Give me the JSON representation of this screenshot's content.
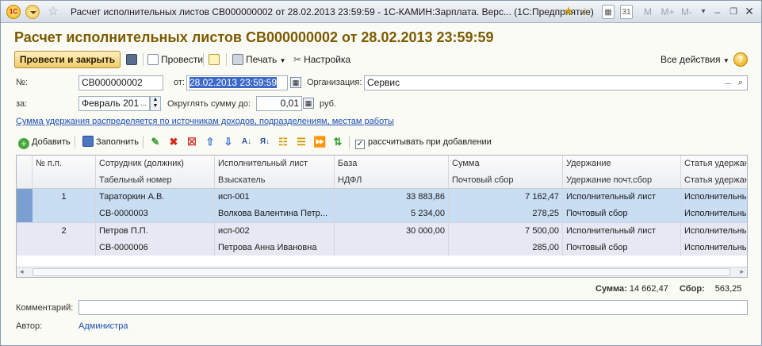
{
  "window": {
    "title": "Расчет исполнительных листов СВ000000002 от 28.02.2013 23:59:59 - 1С-КАМИН:Зарплата. Верс... (1С:Предприятие)",
    "logo_text": "1С",
    "right_controls": [
      "M",
      "M+",
      "M-"
    ]
  },
  "form": {
    "title": "Расчет исполнительных листов СВ000000002 от 28.02.2013 23:59:59"
  },
  "commands": {
    "post_and_close": "Провести и закрыть",
    "post": "Провести",
    "print": "Печать",
    "settings": "Настройка",
    "all_actions": "Все действия",
    "help": "?"
  },
  "fields": {
    "number_label": "№:",
    "number_value": "СВ000000002",
    "date_label": "от:",
    "date_value": "28.02.2013 23:59:59",
    "org_label": "Организация:",
    "org_value": "Сервис",
    "period_label": "за:",
    "period_value": "Февраль 201",
    "round_label": "Округлять сумму до:",
    "round_value": "0,01",
    "round_unit": "руб."
  },
  "info_link": "Сумма удержания распределяется по источникам доходов, подразделениям, местам работы",
  "table_toolbar": {
    "add": "Добавить",
    "fill": "Заполнить",
    "calc_on_add": "рассчитывать при добавлении",
    "calc_on_add_checked": true
  },
  "table": {
    "headers_top": [
      "№ п.п.",
      "Сотрудник (должник)",
      "Исполнительный лист",
      "База",
      "Сумма",
      "Удержание",
      "Статья удержан"
    ],
    "headers_bottom": [
      "",
      "Табельный номер",
      "Взыскатель",
      "НДФЛ",
      "Почтовый сбор",
      "Удержание почт.сбор",
      "Статья удержан"
    ],
    "rows": [
      {
        "num": "1",
        "employee": "Тараторкин А.В.",
        "tab_number": "СВ-0000003",
        "writ": "исп-001",
        "claimant": "Волкова Валентина Петр...",
        "base": "33 883,86",
        "ndfl": "5 234,00",
        "sum": "7 162,47",
        "postal": "278,25",
        "deduction": "Исполнительный лист",
        "postal_deduction": "Почтовый сбор",
        "article": "Исполнительнь",
        "article2": "Исполнительнь"
      },
      {
        "num": "2",
        "employee": "Петров П.П.",
        "tab_number": "СВ-0000006",
        "writ": "исп-002",
        "claimant": "Петрова Анна Ивановна",
        "base": "30 000,00",
        "ndfl": "",
        "sum": "7 500,00",
        "postal": "285,00",
        "deduction": "Исполнительный лист",
        "postal_deduction": "Почтовый сбор",
        "article": "Исполнительнь",
        "article2": "Исполнительнь"
      }
    ]
  },
  "totals": {
    "sum_label": "Сумма:",
    "sum_value": "14 662,47",
    "fee_label": "Сбор:",
    "fee_value": "563,25"
  },
  "comment": {
    "label": "Комментарий:",
    "value": ""
  },
  "author": {
    "label": "Автор:",
    "value": "Администра"
  }
}
